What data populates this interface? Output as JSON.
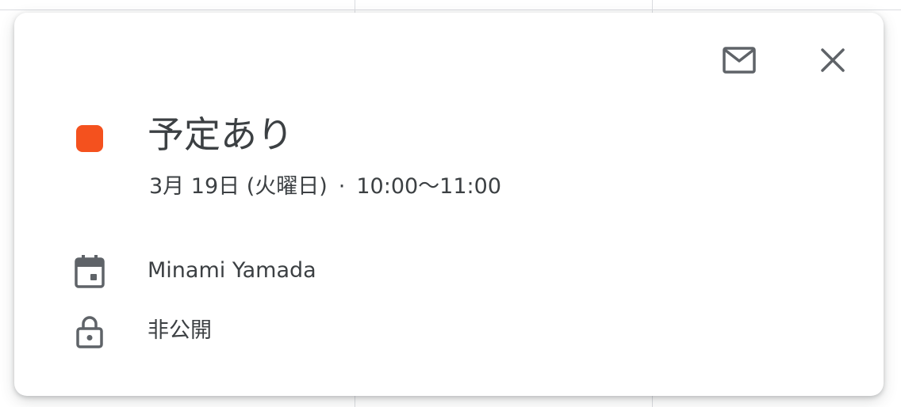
{
  "event": {
    "title": "予定あり",
    "date": "3月 19日 (火曜日)",
    "separator": "·",
    "time": "10:00〜11:00",
    "color": "#f4511e"
  },
  "details": {
    "calendar_owner": "Minami Yamada",
    "visibility": "非公開"
  },
  "toolbar": {
    "email_icon": "mail-icon",
    "close_icon": "close-icon"
  },
  "icons": {
    "calendar": "calendar-icon",
    "lock": "lock-icon"
  }
}
